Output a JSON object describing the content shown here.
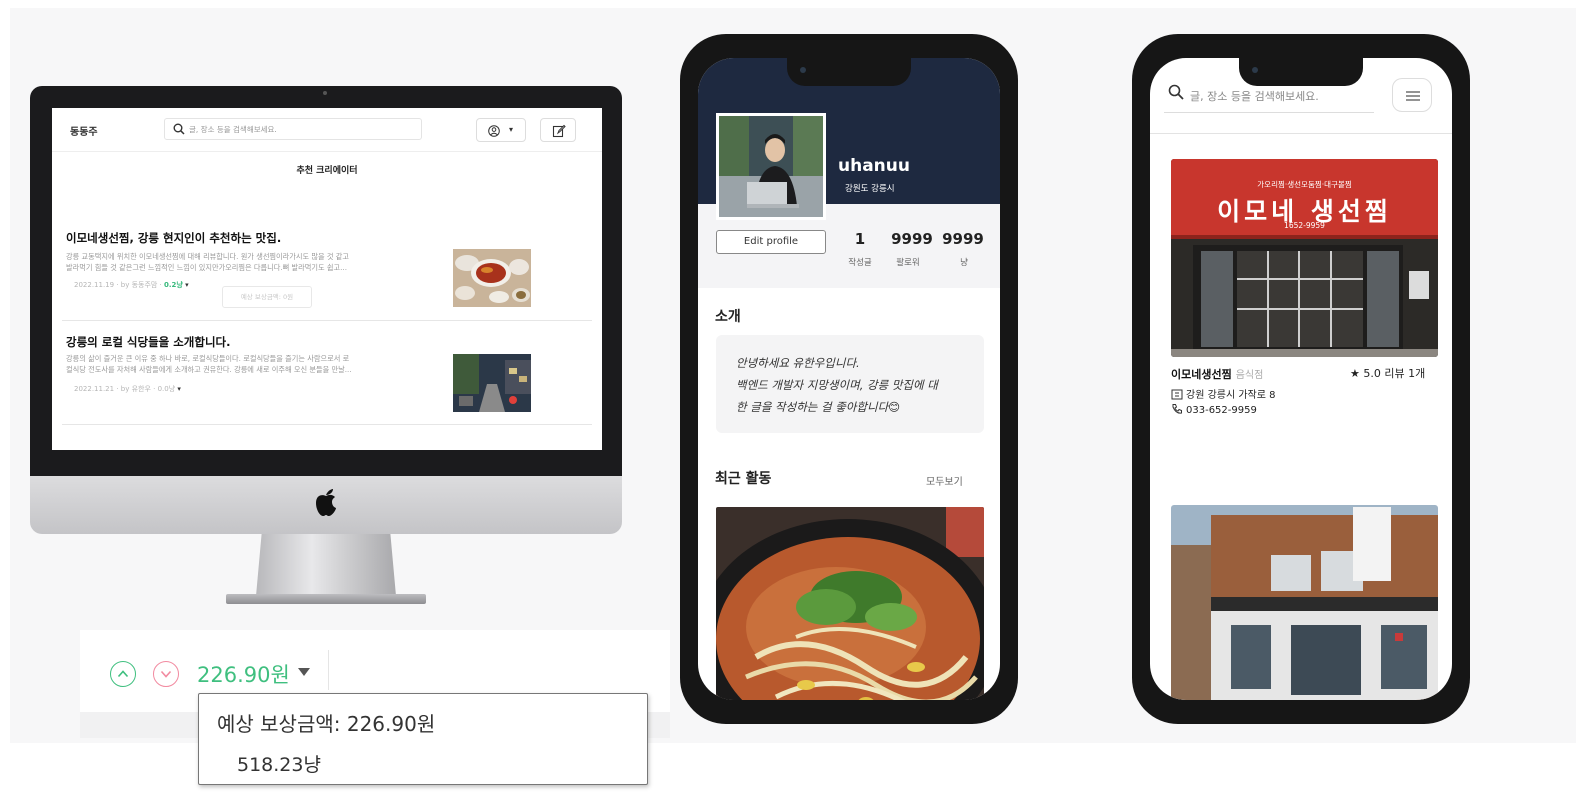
{
  "desktop": {
    "logo": "동동주",
    "search_placeholder": "글, 장소 등을 검색해보세요.",
    "section_title": "추천 크리에이터",
    "posts": [
      {
        "title": "이모네생선찜, 강릉 현지인이 추천하는 맛집.",
        "excerpt_line1": "강릉 교동택지에 위치한 이모네생선찜에 대해 리뷰합니다. 원가 생선찜이라가시도 많을 것 같고",
        "excerpt_line2": "발라먹기 힘들 것 같은그런 느낌적인 느낌이 있지만가오리찜은 다릅니다.뼈 발라먹기도 쉽고...",
        "meta": "2022.11.19 · by 동동주맘 ·",
        "reward": "0.2냥",
        "reward_button": "예상 보상금액: 0원"
      },
      {
        "title": "강릉의 로컬 식당들을 소개합니다.",
        "excerpt_line1": "강릉의 삶이 즐거운 큰 이유 중 하나 바로, 로컬식당들이다. 로컬식당들을 즐기는 사람으로서 로",
        "excerpt_line2": "컬식당 전도사를 자처해 사람들에게 소개하고 권유한다. 강릉에 새로 이주해 오신 분들을 만날...",
        "meta": "2022.11.21 · by 유한우 ·",
        "reward": "0.0냥"
      }
    ]
  },
  "reward_widget": {
    "amount": "226.90원",
    "tooltip_line1": "예상 보상금액: 226.90원",
    "tooltip_line2": "518.23냥",
    "colors": {
      "up": "#3fbf7f",
      "down": "#f28aa0"
    }
  },
  "profile_phone": {
    "username": "uhanuu",
    "location": "강원도 강릉시",
    "edit_button": "Edit profile",
    "stats": [
      {
        "value": "1",
        "label": "작성글"
      },
      {
        "value": "9999",
        "label": "팔로워"
      },
      {
        "value": "9999",
        "label": "냥"
      }
    ],
    "intro_title": "소개",
    "intro_lines": [
      "안녕하세요 유한우입니다.",
      "백엔드 개발자 지망생이며, 강릉 맛집에 대",
      "한 글을 작성하는 걸 좋아합니다😊"
    ],
    "activity_title": "최근 활동",
    "see_all": "모두보기"
  },
  "search_phone": {
    "search_placeholder": "글, 장소 등을 검색해보세요.",
    "place": {
      "name": "이모네생선찜",
      "category": "음식점",
      "rating": "★ 5.0 리뷰 1개",
      "address": "강원 강릉시 가작로 8",
      "phone": "033-652-9959"
    },
    "sign_text": "이모네 생선찜",
    "sign_subtext": "가오리찜·생선모둠찜·대구볼찜",
    "sign_phone": "1652-9959"
  }
}
